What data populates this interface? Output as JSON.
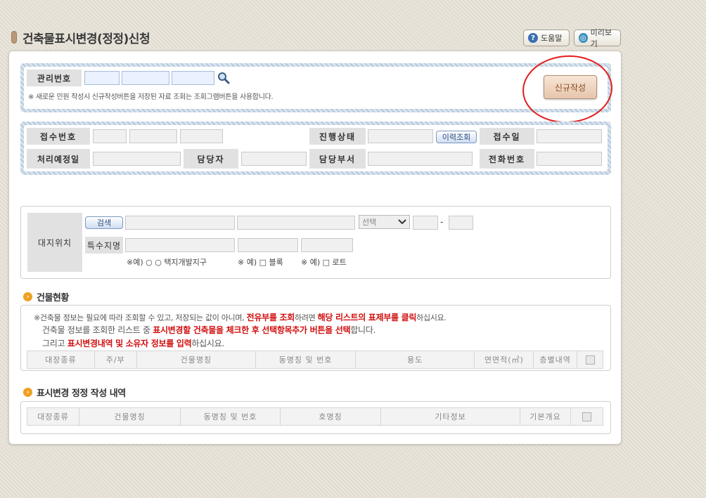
{
  "page": {
    "title": "건축물표시변경(정정)신청"
  },
  "top_buttons": {
    "help": "도움말",
    "help_icon": "?",
    "preview": "미리보기",
    "preview_icon": "◎"
  },
  "mgmt": {
    "label": "관리번호",
    "note": "※ 새로운 민원 작성시 신규작성버튼을 저장된 자료 조회는 조회그램버튼을 사용합니다.",
    "new_button": "신규작성"
  },
  "receipt": {
    "receipt_no": "접수번호",
    "status": "진행상태",
    "history_button": "이력조회",
    "receipt_date": "접수일",
    "due_date": "처리예정일",
    "manager": "담당자",
    "dept": "담당부서",
    "phone": "전화번호"
  },
  "site": {
    "label": "대지위치",
    "search_button": "검색",
    "select_placeholder": "선택",
    "dash": "-",
    "special_label": "특수지명",
    "ex1": "※예) ○ ○ 택지개발지구",
    "ex2": "※ 예) □ 블록",
    "ex3": "※ 예) □ 로트"
  },
  "building": {
    "title": "건물현황",
    "line1_a": "※건축물 정보는 필요에 따라 조회할 수 있고, 저장되는 값이 아니며, ",
    "line1_b": "전유부를 조회",
    "line1_c": "하려면 ",
    "line1_d": "해당 리스트의 표제부를 클릭",
    "line1_e": "하십시요.",
    "line2_a": "건축물 정보를 조회한 리스트 중 ",
    "line2_b": "표시변경할 건축물을 체크한 후 선택항목추가 버튼을 선택",
    "line2_c": "합니다.",
    "line3_a": "그리고 ",
    "line3_b": "표시변경내역 및 소유자 정보를 입력",
    "line3_c": "하십시요.",
    "columns": [
      "대장종류",
      "주/부",
      "건물명칭",
      "동명칭 및 번호",
      "용도",
      "연면적(㎡)",
      "층별내역"
    ]
  },
  "correction": {
    "title": "표시변경 정정 작성 내역",
    "columns": [
      "대장종류",
      "건물명칭",
      "동명칭 및 번호",
      "호명칭",
      "기타정보",
      "기본개요"
    ]
  },
  "colors": {
    "accent_red": "#d21010",
    "hatch_blue": "#b7c9dc",
    "new_btn": "#e6c6ad"
  }
}
